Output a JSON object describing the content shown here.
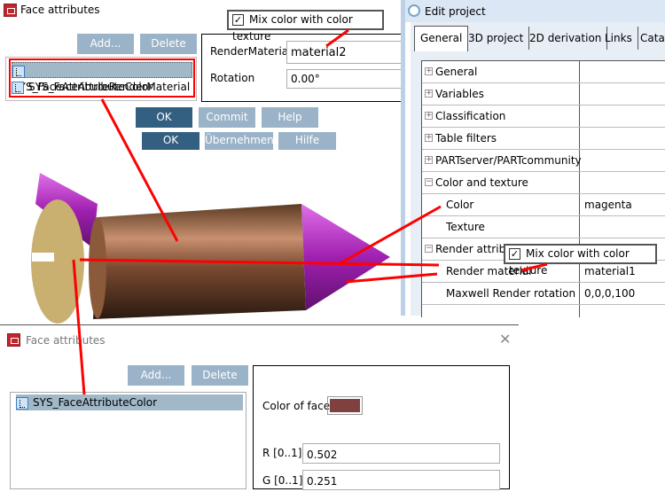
{
  "top_dialog": {
    "title": "Face attributes",
    "add_label": "Add...",
    "delete_label": "Delete",
    "items": [
      "SYS_FaceAttributeRenderMaterial",
      "SYS_FaceAttributeColor"
    ],
    "render_material_label": "RenderMaterial",
    "render_material_value": "material2",
    "rotation_label": "Rotation",
    "rotation_value": "0.00°",
    "mix_label": "Mix color with color texture",
    "buttons_en": [
      "OK",
      "Commit",
      "Help"
    ],
    "buttons_de": [
      "OK",
      "Übernehmen",
      "Hilfe"
    ]
  },
  "edit_project": {
    "title": "Edit project",
    "tabs": [
      "General",
      "3D project",
      "2D derivation",
      "Links",
      "Catalo"
    ],
    "rows": [
      {
        "name": "General",
        "value": "",
        "kind": "plus"
      },
      {
        "name": "Variables",
        "value": "",
        "kind": "plus"
      },
      {
        "name": "Classification",
        "value": "",
        "kind": "plus"
      },
      {
        "name": "Table filters",
        "value": "",
        "kind": "plus"
      },
      {
        "name": "PARTserver/PARTcommunity",
        "value": "",
        "kind": "plus"
      },
      {
        "name": "Color and texture",
        "value": "",
        "kind": "minus"
      },
      {
        "name": "Color",
        "value": "magenta",
        "kind": "sub"
      },
      {
        "name": "Texture",
        "value": "",
        "kind": "sub"
      },
      {
        "name": "Render attributes",
        "value": "",
        "kind": "minus"
      },
      {
        "name": "Render material",
        "value": "material1",
        "kind": "sub"
      },
      {
        "name": "Maxwell Render rotation",
        "value": "0,0,0,100",
        "kind": "sub"
      }
    ],
    "mix_label": "Mix color with color texture"
  },
  "bottom_dialog": {
    "title": "Face attributes",
    "add_label": "Add...",
    "delete_label": "Delete",
    "items": [
      "SYS_FaceAttributeColor"
    ],
    "color_label": "Color of face",
    "color_hex": "#7f4040",
    "r_label": "R [0..1]:",
    "r_value": "0.502",
    "g_label": "G [0..1]:",
    "g_value": "0.251"
  },
  "colors": {
    "annotation": "#ff0000",
    "primary_button": "#335f80",
    "disabled_button": "#9ab3c8"
  }
}
